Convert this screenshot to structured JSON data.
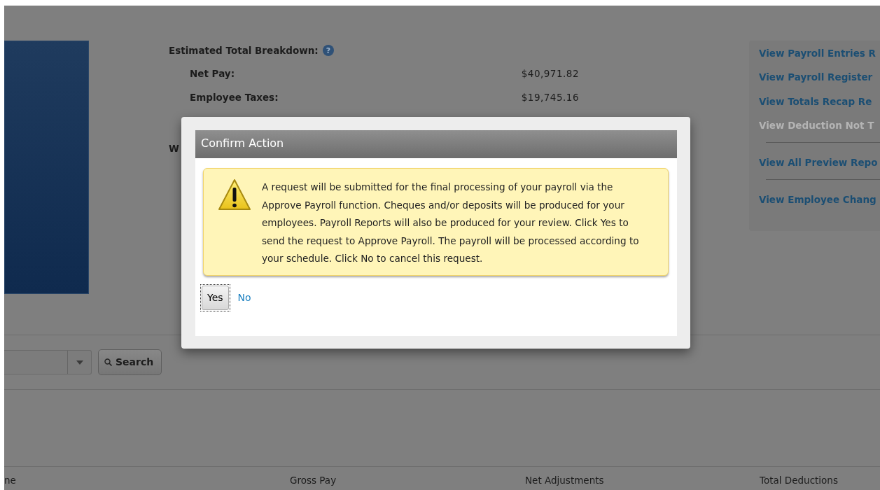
{
  "summary": {
    "title": "Estimated Total Breakdown:",
    "rows": [
      {
        "label": "Net Pay:",
        "value": "$40,971.82"
      },
      {
        "label": "Employee Taxes:",
        "value": "$19,745.16"
      }
    ],
    "partial_label": "W",
    "help_label": "?"
  },
  "report_link_groups": [
    [
      {
        "label": "View Payroll Entries R",
        "disabled": false
      },
      {
        "label": "View Payroll Register",
        "disabled": false
      },
      {
        "label": "View Totals Recap Re",
        "disabled": false
      },
      {
        "label": "View Deduction Not T",
        "disabled": true
      }
    ],
    [
      {
        "label": "View All Preview Repo",
        "disabled": false
      }
    ],
    [
      {
        "label": "View Employee Chang",
        "disabled": false
      }
    ]
  ],
  "search": {
    "button": "Search"
  },
  "table": {
    "columns": [
      "ne",
      "Gross Pay",
      "Net Adjustments",
      "Total Deductions"
    ]
  },
  "dialog": {
    "title": "Confirm Action",
    "message": "A request will be submitted for the final processing of your payroll via the Approve Payroll function. Cheques and/or deposits will be produced for your employees. Payroll Reports will also be produced for your review. Click Yes to send the request to Approve Payroll. The payroll will be processed according to your schedule. Click No to cancel this request.",
    "buttons": [
      {
        "label": "Yes",
        "kind": "button"
      },
      {
        "label": "No",
        "kind": "link"
      }
    ]
  }
}
